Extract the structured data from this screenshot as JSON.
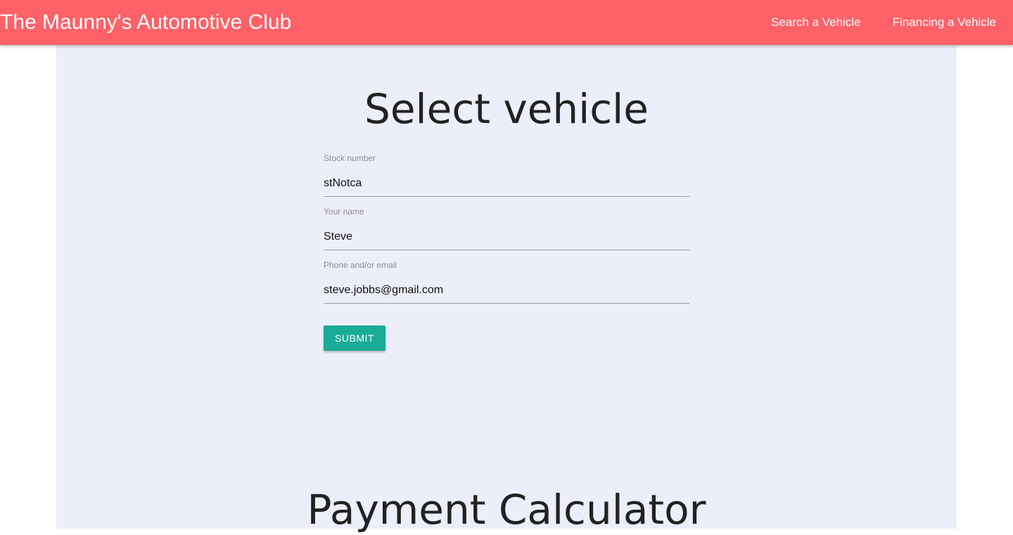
{
  "navbar": {
    "brand": "The Maunny's Automotive Club",
    "links": [
      {
        "label": "Search a Vehicle"
      },
      {
        "label": "Financing a Vehicle"
      }
    ],
    "color": "#ff6168"
  },
  "select_vehicle": {
    "title": "Select vehicle",
    "fields": [
      {
        "label": "Stock number",
        "value": "stNotca"
      },
      {
        "label": "Your name",
        "value": "Steve"
      },
      {
        "label": "Phone and/or email",
        "value": "steve.jobbs@gmail.com"
      }
    ],
    "submit_label": "SUBMIT",
    "submit_color": "#1aab97"
  },
  "payment_calculator": {
    "title": "Payment Calculator"
  },
  "colors": {
    "background": "#eceef9"
  }
}
